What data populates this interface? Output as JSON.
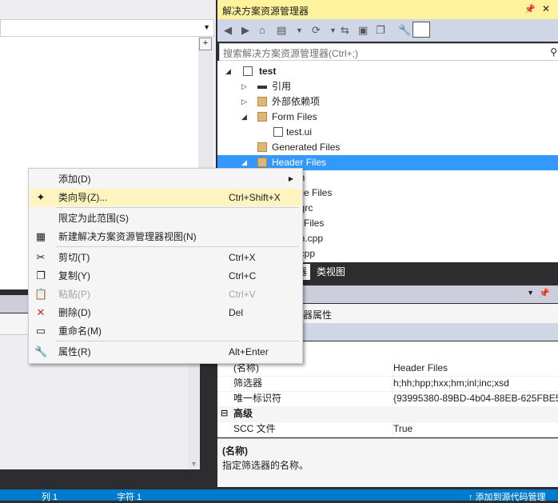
{
  "solution_explorer": {
    "title": "解决方案资源管理器",
    "pin_icon": "pin-icon",
    "close_icon": "close-icon",
    "search_placeholder": "搜索解决方案资源管理器(Ctrl+;)",
    "tree": [
      {
        "label": "test",
        "level": 0
      },
      {
        "label": "引用",
        "level": 1
      },
      {
        "label": "外部依赖项",
        "level": 1
      },
      {
        "label": "Form Files",
        "level": 1
      },
      {
        "label": "test.ui",
        "level": 2
      },
      {
        "label": "Generated Files",
        "level": 1
      },
      {
        "label": "Header Files",
        "level": 1
      },
      {
        "label": "t.h",
        "level": 2
      },
      {
        "label": "rce Files",
        "level": 1
      },
      {
        "label": "t.qrc",
        "level": 2
      },
      {
        "label": "e Files",
        "level": 1
      },
      {
        "label": "in.cpp",
        "level": 2
      },
      {
        "label": "t.cpp",
        "level": 2
      }
    ],
    "tabs": [
      "器",
      "类视图"
    ]
  },
  "properties": {
    "subtitle": "选器属性",
    "rows": [
      {
        "k": "(名称)",
        "v": "Header Files"
      },
      {
        "k": "筛选器",
        "v": "h;hh;hpp;hxx;hm;inl;inc;xsd"
      },
      {
        "k": "唯一标识符",
        "v": "{93995380-89BD-4b04-88EB-625FBE52EBFB}"
      }
    ],
    "category": "高级",
    "minus": "⊟",
    "rows2": [
      {
        "k": "SCC 文件",
        "v": "True"
      }
    ],
    "desc_name": "(名称)",
    "desc_text": "指定筛选器的名称。"
  },
  "context_menu": {
    "items": [
      {
        "label": "添加(D)",
        "shortcut": "",
        "submenu": true
      },
      {
        "label": "类向导(Z)...",
        "shortcut": "Ctrl+Shift+X",
        "highlight": true
      },
      {
        "label": "限定为此范围(S)",
        "shortcut": ""
      },
      {
        "label": "新建解决方案资源管理器视图(N)",
        "shortcut": ""
      },
      {
        "label": "剪切(T)",
        "shortcut": "Ctrl+X"
      },
      {
        "label": "复制(Y)",
        "shortcut": "Ctrl+C"
      },
      {
        "label": "粘贴(P)",
        "shortcut": "Ctrl+V",
        "disabled": true
      },
      {
        "label": "删除(D)",
        "shortcut": "Del"
      },
      {
        "label": "重命名(M)",
        "shortcut": ""
      },
      {
        "label": "属性(R)",
        "shortcut": "Alt+Enter"
      }
    ]
  },
  "status_bar": {
    "left": "列 1",
    "mid": "字符 1",
    "right": "↑ 添加到源代码管理"
  }
}
